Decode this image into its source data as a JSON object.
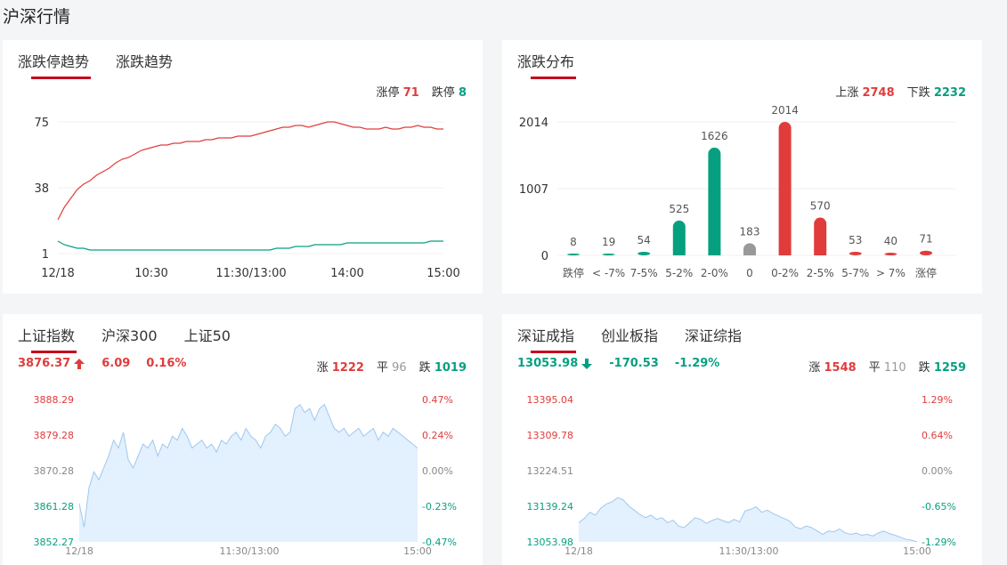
{
  "page_title": "沪深行情",
  "colors": {
    "up": "#e03c3c",
    "down": "#06a081",
    "flat": "#999999",
    "accent": "#c40c1e",
    "area": "#e3f0fd",
    "area_line": "#9ec8f0"
  },
  "limit_trend": {
    "tabs": [
      "涨跌停趋势",
      "涨跌趋势"
    ],
    "summary": {
      "up_label": "涨停",
      "up_value": "71",
      "down_label": "跌停",
      "down_value": "8"
    },
    "chart_data": {
      "type": "line",
      "y_ticks": [
        "75",
        "38",
        "1"
      ],
      "ylim": [
        1,
        75
      ],
      "x_ticks": [
        "12/18",
        "10:30",
        "11:30/13:00",
        "14:00",
        "15:00"
      ],
      "series": [
        {
          "key": "limit_up",
          "color": "#e03c3c",
          "values": [
            20,
            27,
            32,
            37,
            40,
            42,
            45,
            47,
            49,
            52,
            54,
            55,
            57,
            59,
            60,
            61,
            62,
            62,
            63,
            63,
            64,
            64,
            64,
            65,
            65,
            66,
            66,
            66,
            67,
            67,
            67,
            68,
            69,
            70,
            71,
            72,
            72,
            73,
            73,
            72,
            73,
            74,
            75,
            75,
            74,
            73,
            72,
            72,
            71,
            71,
            71,
            72,
            71,
            71,
            72,
            72,
            73,
            72,
            72,
            71,
            71
          ]
        },
        {
          "key": "limit_down",
          "color": "#06a081",
          "values": [
            8,
            6,
            5,
            4,
            4,
            3,
            3,
            3,
            3,
            3,
            3,
            3,
            3,
            3,
            3,
            3,
            3,
            3,
            3,
            3,
            3,
            3,
            3,
            3,
            3,
            3,
            3,
            3,
            3,
            3,
            3,
            3,
            3,
            3,
            4,
            4,
            4,
            5,
            5,
            5,
            6,
            6,
            6,
            6,
            6,
            7,
            7,
            7,
            7,
            7,
            7,
            7,
            7,
            7,
            7,
            7,
            7,
            7,
            8,
            8,
            8
          ]
        }
      ]
    }
  },
  "distribution": {
    "tabs": [
      "涨跌分布"
    ],
    "summary": {
      "up_label": "上涨",
      "up_value": "2748",
      "down_label": "下跌",
      "down_value": "2232"
    },
    "chart_data": {
      "type": "bar",
      "y_ticks": [
        "2014",
        "1007",
        "0"
      ],
      "ylim": [
        0,
        2014
      ],
      "categories": [
        "跌停",
        "< -7%",
        "7-5%",
        "5-2%",
        "2-0%",
        "0",
        "0-2%",
        "2-5%",
        "5-7%",
        "> 7%",
        "涨停"
      ],
      "values": [
        8,
        19,
        54,
        525,
        1626,
        183,
        2014,
        570,
        53,
        40,
        71
      ],
      "bar_colors": [
        "down",
        "down",
        "down",
        "down",
        "down",
        "flat",
        "up",
        "up",
        "up",
        "up",
        "up"
      ]
    }
  },
  "sh_index": {
    "tabs": [
      "上证指数",
      "沪深300",
      "上证50"
    ],
    "quote": {
      "price": "3876.37",
      "change": "6.09",
      "percent": "0.16%",
      "direction": "up"
    },
    "breadth": {
      "up_label": "涨",
      "up_value": "1222",
      "flat_label": "平",
      "flat_value": "96",
      "down_label": "跌",
      "down_value": "1019"
    },
    "chart_data": {
      "type": "area",
      "y_left": [
        "3888.29",
        "3879.28",
        "3870.28",
        "3861.28",
        "3852.27"
      ],
      "y_right": [
        "0.47%",
        "0.24%",
        "0.00%",
        "-0.23%",
        "-0.47%"
      ],
      "ylim": [
        3852.27,
        3888.29
      ],
      "x_ticks": [
        "12/18",
        "11:30/13:00",
        "15:00"
      ],
      "values": [
        3862,
        3856,
        3866,
        3870,
        3868,
        3871,
        3874,
        3878,
        3876,
        3880,
        3873,
        3871,
        3874,
        3877,
        3876,
        3878,
        3874,
        3877,
        3876,
        3879,
        3878,
        3881,
        3879,
        3876,
        3877,
        3878,
        3876,
        3877,
        3875,
        3878,
        3877,
        3879,
        3880,
        3878,
        3881,
        3879,
        3878,
        3876,
        3879,
        3880,
        3882,
        3881,
        3879,
        3880,
        3886,
        3887,
        3885,
        3886,
        3883,
        3886,
        3887,
        3884,
        3881,
        3880,
        3881,
        3879,
        3880,
        3881,
        3879,
        3880,
        3881,
        3878,
        3880,
        3879,
        3881,
        3880,
        3879,
        3878,
        3877,
        3876
      ]
    }
  },
  "sz_index": {
    "tabs": [
      "深证成指",
      "创业板指",
      "深证综指"
    ],
    "quote": {
      "price": "13053.98",
      "change": "-170.53",
      "percent": "-1.29%",
      "direction": "down"
    },
    "breadth": {
      "up_label": "涨",
      "up_value": "1548",
      "flat_label": "平",
      "flat_value": "110",
      "down_label": "跌",
      "down_value": "1259"
    },
    "chart_data": {
      "type": "area",
      "y_left": [
        "13395.04",
        "13309.78",
        "13224.51",
        "13139.24",
        "13053.98"
      ],
      "y_right": [
        "1.29%",
        "0.64%",
        "0.00%",
        "-0.65%",
        "-1.29%"
      ],
      "ylim": [
        13053.98,
        13395.04
      ],
      "x_ticks": [
        "12/18",
        "11:30/13:00",
        "15:00"
      ],
      "values": [
        13100,
        13110,
        13125,
        13118,
        13135,
        13145,
        13150,
        13160,
        13155,
        13140,
        13130,
        13120,
        13112,
        13118,
        13108,
        13112,
        13100,
        13106,
        13092,
        13088,
        13100,
        13112,
        13108,
        13098,
        13105,
        13110,
        13105,
        13100,
        13108,
        13102,
        13128,
        13132,
        13138,
        13125,
        13130,
        13122,
        13116,
        13110,
        13104,
        13090,
        13085,
        13092,
        13088,
        13080,
        13072,
        13080,
        13078,
        13085,
        13076,
        13072,
        13075,
        13070,
        13072,
        13068,
        13075,
        13080,
        13074,
        13070,
        13065,
        13060,
        13058,
        13054
      ]
    }
  }
}
